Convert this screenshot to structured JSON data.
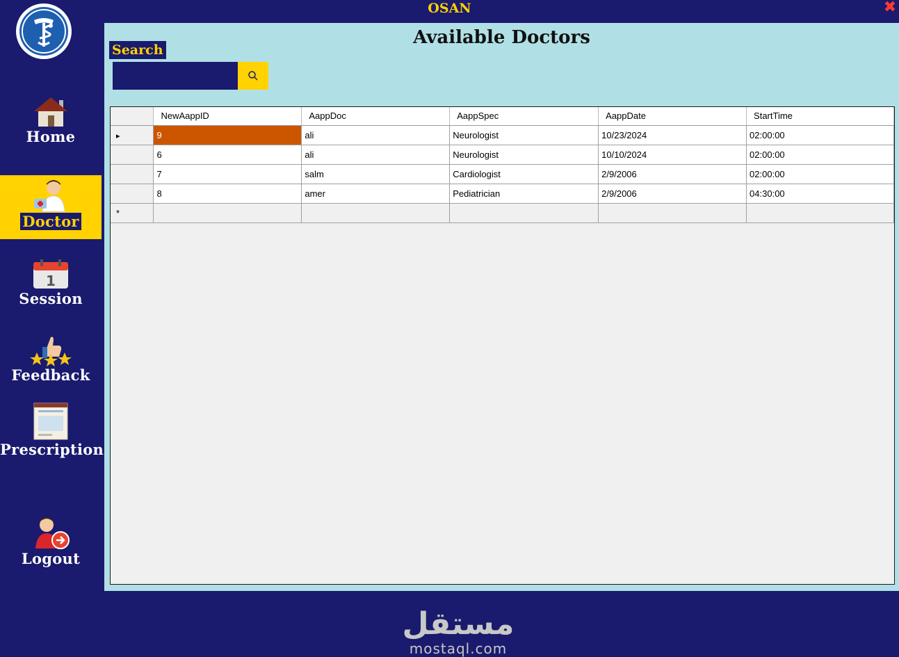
{
  "window": {
    "title": "OSAN",
    "close_glyph": "✖"
  },
  "sidebar": {
    "items": [
      {
        "label": "Home",
        "icon": "home-icon",
        "active": false
      },
      {
        "label": "Doctor",
        "icon": "doctor-icon",
        "active": true
      },
      {
        "label": "Session",
        "icon": "calendar-icon",
        "active": false
      },
      {
        "label": "Feedback",
        "icon": "thumbs-up-stars-icon",
        "active": false
      },
      {
        "label": "Prescription",
        "icon": "prescription-icon",
        "active": false
      },
      {
        "label": "Logout",
        "icon": "logout-icon",
        "active": false
      }
    ]
  },
  "main": {
    "heading": "Available Doctors",
    "search": {
      "label": "Search",
      "value": "",
      "placeholder": ""
    },
    "grid": {
      "columns": [
        "NewAappID",
        "AappDoc",
        "AappSpec",
        "AappDate",
        "StartTime"
      ],
      "rows": [
        [
          "9",
          "ali",
          "Neurologist",
          "10/23/2024",
          "02:00:00"
        ],
        [
          "6",
          "ali",
          "Neurologist",
          "10/10/2024",
          "02:00:00"
        ],
        [
          "7",
          "salm",
          "Cardiologist",
          "2/9/2006",
          "02:00:00"
        ],
        [
          "8",
          "amer",
          "Pediatrician",
          "2/9/2006",
          "04:30:00"
        ]
      ],
      "current_row_marker": "▸",
      "new_row_marker": "*"
    },
    "watermark": {
      "arabic": "مستقل",
      "latin": "mostaql.com"
    }
  },
  "colors": {
    "navy": "#1a1a6e",
    "yellow": "#ffd200",
    "content_bg": "#b0e0e6",
    "selection": "#cc5500",
    "close": "#ff3b2f"
  }
}
